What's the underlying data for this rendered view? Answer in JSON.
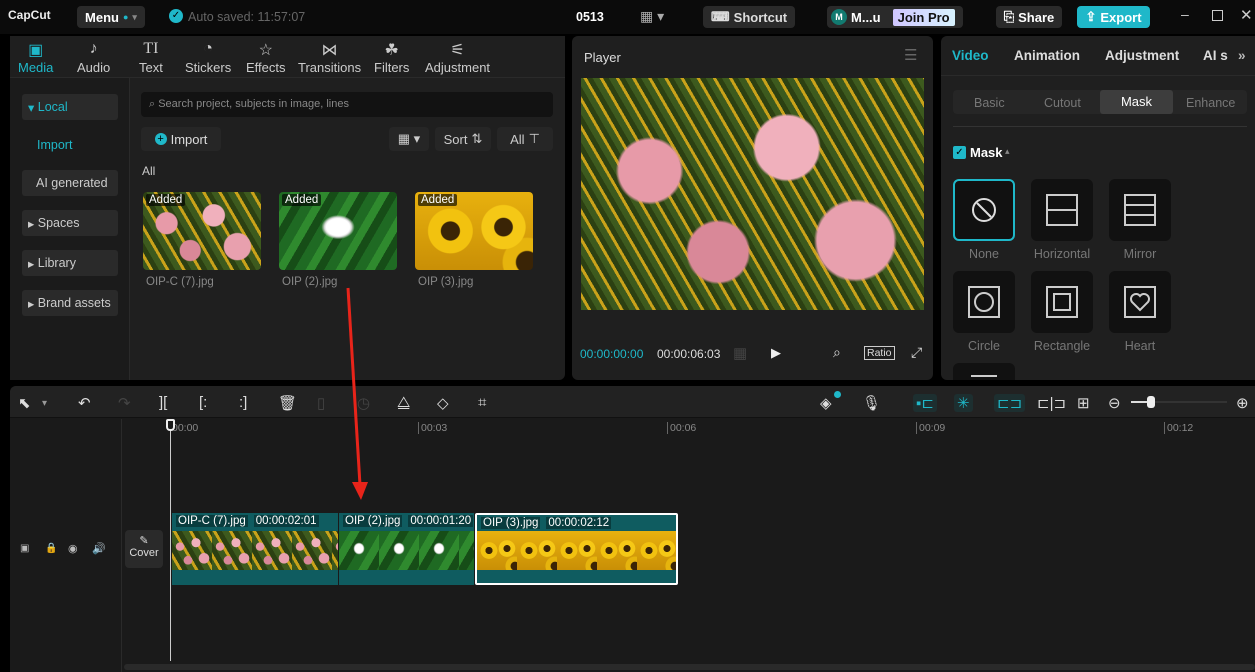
{
  "topbar": {
    "logo": "CapCut",
    "menu": "Menu",
    "autosave": "Auto saved: 11:57:07",
    "project": "0513",
    "shortcut": "Shortcut",
    "user": "M...u",
    "user_initial": "M",
    "join_pro": "Join Pro",
    "share": "Share",
    "export": "Export"
  },
  "media_tabs": [
    {
      "label": "Media",
      "icon": "media-icon"
    },
    {
      "label": "Audio",
      "icon": "audio-icon"
    },
    {
      "label": "Text",
      "icon": "text-icon"
    },
    {
      "label": "Stickers",
      "icon": "sticker-icon"
    },
    {
      "label": "Effects",
      "icon": "effects-icon"
    },
    {
      "label": "Transitions",
      "icon": "transitions-icon"
    },
    {
      "label": "Filters",
      "icon": "filters-icon"
    },
    {
      "label": "Adjustment",
      "icon": "adjustment-icon"
    }
  ],
  "sidebar": {
    "items": [
      "Local",
      "Import",
      "AI generated",
      "Spaces",
      "Library",
      "Brand assets"
    ]
  },
  "media": {
    "search_placeholder": "Search project, subjects in image, lines",
    "import": "Import",
    "sort": "Sort",
    "all_filter": "All",
    "section": "All",
    "items": [
      {
        "name": "OIP-C (7).jpg",
        "badge": "Added"
      },
      {
        "name": "OIP (2).jpg",
        "badge": "Added"
      },
      {
        "name": "OIP (3).jpg",
        "badge": "Added"
      }
    ]
  },
  "player": {
    "title": "Player",
    "current_time": "00:00:00:00",
    "total_time": "00:00:06:03",
    "ratio": "Ratio"
  },
  "inspector": {
    "tabs": [
      "Video",
      "Animation",
      "Adjustment",
      "AI s"
    ],
    "subtabs": [
      "Basic",
      "Cutout",
      "Mask",
      "Enhance"
    ],
    "active_subtab": "Mask",
    "section": "Mask",
    "masks": [
      "None",
      "Horizontal",
      "Mirror",
      "Circle",
      "Rectangle",
      "Heart"
    ],
    "accent": "#1fb8c9"
  },
  "timeline": {
    "ruler": [
      "00:00",
      "00:03",
      "00:06",
      "00:09",
      "00:12"
    ],
    "cover": "Cover",
    "zoom_level": 0.08,
    "clips": [
      {
        "name": "OIP-C (7).jpg",
        "duration": "00:00:02:01"
      },
      {
        "name": "OIP (2).jpg",
        "duration": "00:00:01:20"
      },
      {
        "name": "OIP (3).jpg",
        "duration": "00:00:02:12"
      }
    ]
  }
}
